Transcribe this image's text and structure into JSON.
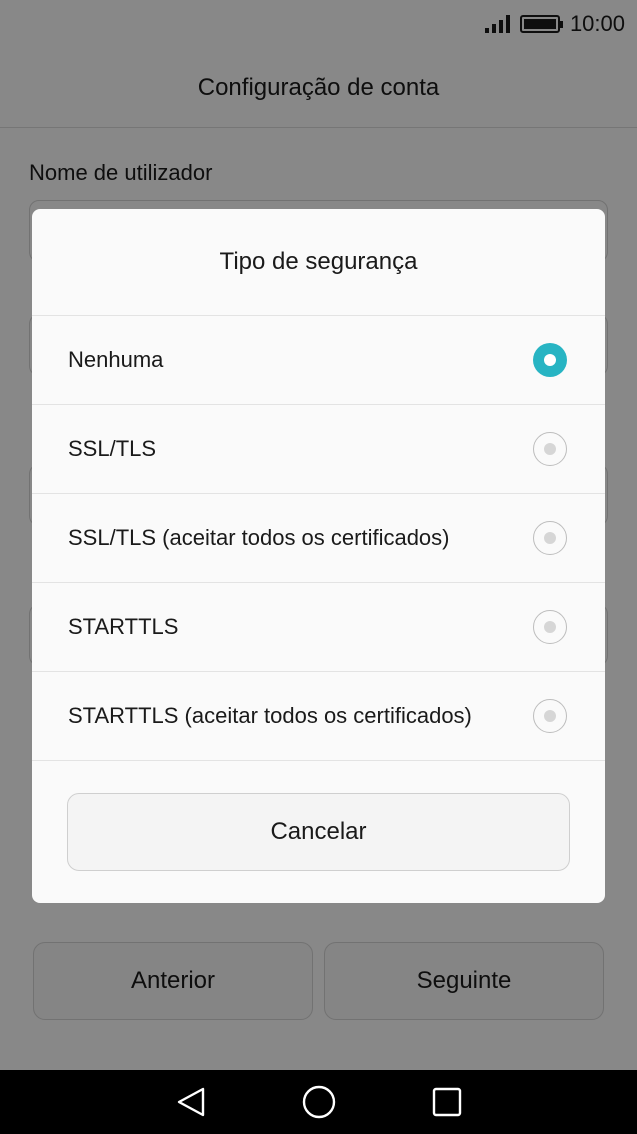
{
  "status_bar": {
    "time": "10:00"
  },
  "header": {
    "title": "Configuração de conta"
  },
  "form": {
    "username_label": "Nome de utilizador"
  },
  "footer": {
    "previous_label": "Anterior",
    "next_label": "Seguinte"
  },
  "dialog": {
    "title": "Tipo de segurança",
    "options": [
      {
        "label": "Nenhuma",
        "selected": true
      },
      {
        "label": "SSL/TLS",
        "selected": false
      },
      {
        "label": "SSL/TLS (aceitar todos os certificados)",
        "selected": false
      },
      {
        "label": "STARTTLS",
        "selected": false
      },
      {
        "label": "STARTTLS (aceitar todos os certificados)",
        "selected": false
      }
    ],
    "cancel_label": "Cancelar"
  },
  "colors": {
    "accent": "#27b4c3"
  },
  "icons": {
    "nav_back": "back-triangle-icon",
    "nav_home": "home-circle-icon",
    "nav_recents": "recents-square-icon"
  }
}
